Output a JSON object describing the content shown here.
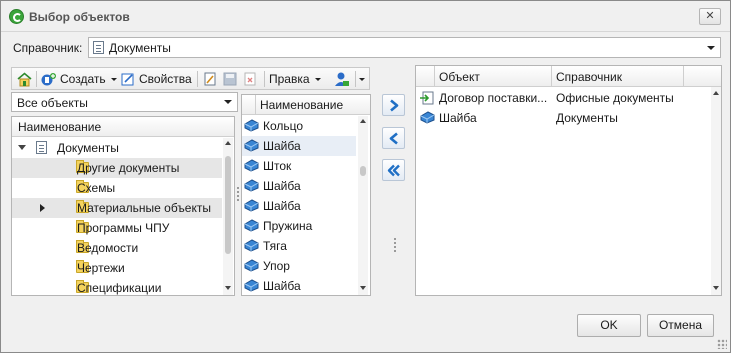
{
  "window": {
    "title": "Выбор объектов",
    "close_glyph": "✕"
  },
  "directory": {
    "label": "Справочник:",
    "value": "Документы"
  },
  "toolbar": {
    "create_label": "Создать",
    "properties_label": "Свойства",
    "edit_label": "Правка"
  },
  "filter": {
    "value": "Все объекты"
  },
  "tree": {
    "header": "Наименование",
    "items": [
      {
        "label": "Документы",
        "level": 0,
        "expander": "open",
        "icon": "document-icon"
      },
      {
        "label": "Другие документы",
        "level": 1,
        "expander": "",
        "icon": "folder-icon"
      },
      {
        "label": "Схемы",
        "level": 1,
        "expander": "",
        "icon": "folder-icon"
      },
      {
        "label": "Материальные объекты",
        "level": 1,
        "expander": "closed",
        "icon": "folder-icon"
      },
      {
        "label": "Программы ЧПУ",
        "level": 1,
        "expander": "",
        "icon": "folder-icon"
      },
      {
        "label": "Ведомости",
        "level": 1,
        "expander": "",
        "icon": "folder-icon"
      },
      {
        "label": "Чертежи",
        "level": 1,
        "expander": "",
        "icon": "folder-icon"
      },
      {
        "label": "Спецификации",
        "level": 1,
        "expander": "",
        "icon": "folder-icon"
      }
    ]
  },
  "items_list": {
    "header": "Наименование",
    "items": [
      "Кольцо",
      "Шайба",
      "Шток",
      "Шайба",
      "Шайба",
      "Пружина",
      "Тяга",
      "Упор",
      "Шайба"
    ]
  },
  "selected": {
    "columns": [
      "Объект",
      "Справочник"
    ],
    "rows": [
      {
        "object": "Договор поставки...",
        "directory": "Офисные документы",
        "icon": "document-arrow-icon"
      },
      {
        "object": "Шайба",
        "directory": "Документы",
        "icon": "part-icon"
      }
    ]
  },
  "footer": {
    "ok_label": "OK",
    "cancel_label": "Отмена"
  },
  "colors": {
    "accent_blue": "#1f6fc5",
    "selection": "#e8eef6",
    "folder": "#f4d35e"
  }
}
